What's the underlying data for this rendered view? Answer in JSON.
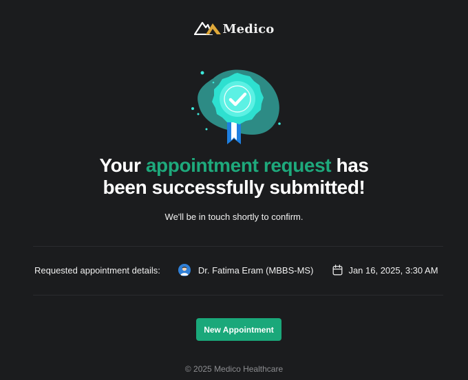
{
  "brand": {
    "name": "Medico",
    "icon": "mountain-logo-icon"
  },
  "hero": {
    "icon": "certified-badge-icon",
    "headline_pre": "Your ",
    "headline_accent": "appointment request",
    "headline_post_line1": " has",
    "headline_line2": "been successfully submitted!",
    "subtext": "We'll be in touch shortly to confirm."
  },
  "details": {
    "label": "Requested appointment details:",
    "doctor": "Dr. Fatima Eram (MBBS-MS)",
    "doctor_icon": "doctor-avatar",
    "datetime": "Jan 16, 2025, 3:30 AM",
    "datetime_icon": "calendar-icon"
  },
  "actions": {
    "new_appointment_label": "New Appointment"
  },
  "footer": {
    "copyright": "© 2025 Medico Healthcare"
  },
  "colors": {
    "background": "#1b1c1e",
    "accent": "#1ea97c",
    "button": "#1aa87a",
    "badge": "#3de8da",
    "ribbon": "#1e7fe0"
  }
}
